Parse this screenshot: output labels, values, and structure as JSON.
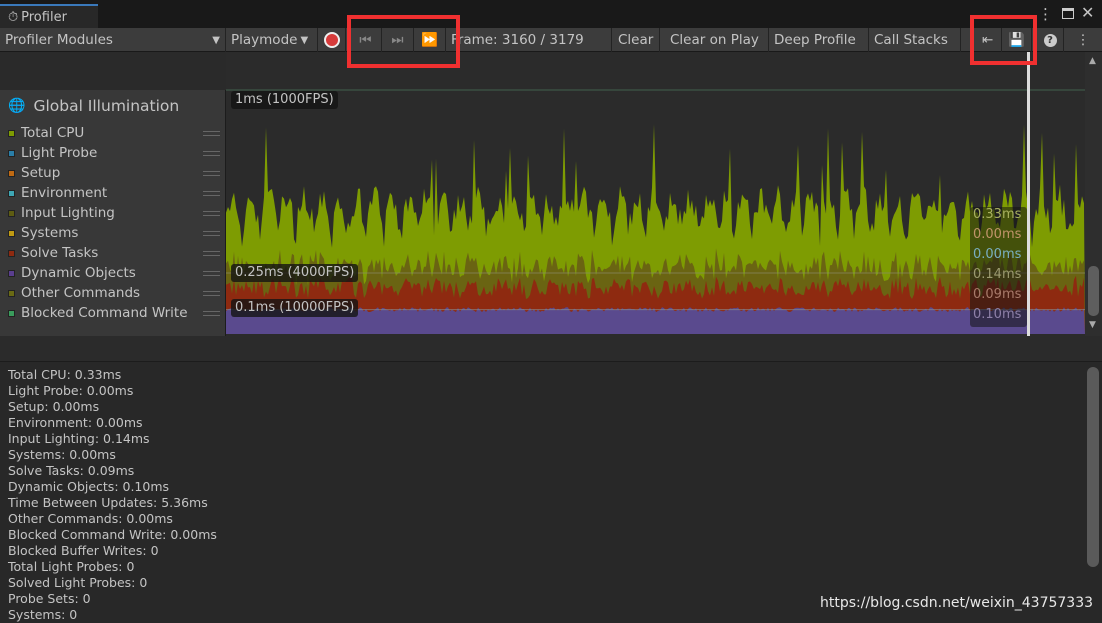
{
  "window": {
    "tab_title": "Profiler"
  },
  "toolbar": {
    "modules": "Profiler Modules",
    "playmode": "Playmode",
    "frame": "Frame: 3160 / 3179",
    "clear": "Clear",
    "clear_on_play": "Clear on Play",
    "deep_profile": "Deep Profile",
    "call_stacks": "Call Stacks"
  },
  "module": {
    "title": "Global Illumination",
    "legend": [
      {
        "label": "Total CPU",
        "color": "#7e9c02"
      },
      {
        "label": "Light Probe",
        "color": "#2a7ea8"
      },
      {
        "label": "Setup",
        "color": "#c06a12"
      },
      {
        "label": "Environment",
        "color": "#3ea6b4"
      },
      {
        "label": "Input Lighting",
        "color": "#5e5c12"
      },
      {
        "label": "Systems",
        "color": "#c09a12"
      },
      {
        "label": "Solve Tasks",
        "color": "#8e2a10"
      },
      {
        "label": "Dynamic Objects",
        "color": "#5a3e8e"
      },
      {
        "label": "Other Commands",
        "color": "#6a6a14"
      },
      {
        "label": "Blocked Command Write",
        "color": "#3a9c5c"
      }
    ]
  },
  "chart": {
    "scale_labels": [
      "1ms (1000FPS)",
      "0.25ms (4000FPS)",
      "0.1ms (10000FPS)"
    ],
    "selected_values": [
      {
        "text": "0.33ms",
        "color": "#a8b060"
      },
      {
        "text": "0.00ms",
        "color": "#c0946a"
      },
      {
        "text": "0.00ms",
        "color": "#7aaec0"
      },
      {
        "text": "0.14ms",
        "color": "#9c9a70"
      },
      {
        "text": "0.09ms",
        "color": "#a87a6a"
      },
      {
        "text": "0.10ms",
        "color": "#8e80a8"
      }
    ]
  },
  "details": [
    "Total CPU: 0.33ms",
    "Light Probe: 0.00ms",
    "Setup: 0.00ms",
    "Environment: 0.00ms",
    "Input Lighting: 0.14ms",
    "Systems: 0.00ms",
    "Solve Tasks: 0.09ms",
    "Dynamic Objects: 0.10ms",
    "Time Between Updates: 5.36ms",
    "Other Commands: 0.00ms",
    "Blocked Command Write: 0.00ms",
    "Blocked Buffer Writes: 0",
    "Total Light Probes: 0",
    "Solved Light Probes: 0",
    "Probe Sets: 0",
    "Systems: 0"
  ],
  "watermark": "https://blog.csdn.net/weixin_43757333"
}
